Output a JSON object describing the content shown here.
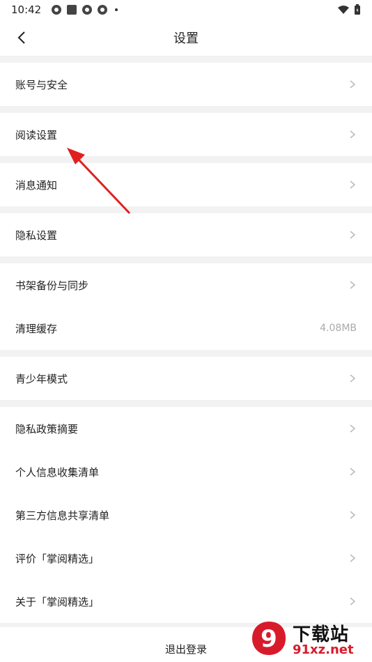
{
  "statusbar": {
    "time": "10:42"
  },
  "navbar": {
    "title": "设置"
  },
  "groups": [
    [
      {
        "label": "账号与安全"
      }
    ],
    [
      {
        "label": "阅读设置"
      }
    ],
    [
      {
        "label": "消息通知"
      }
    ],
    [
      {
        "label": "隐私设置"
      }
    ],
    [
      {
        "label": "书架备份与同步"
      },
      {
        "label": "清理缓存",
        "value": "4.08MB"
      }
    ],
    [
      {
        "label": "青少年模式"
      }
    ],
    [
      {
        "label": "隐私政策摘要"
      },
      {
        "label": "个人信息收集清单"
      },
      {
        "label": "第三方信息共享清单"
      },
      {
        "label": "评价「掌阅精选」"
      },
      {
        "label": "关于「掌阅精选」"
      }
    ]
  ],
  "logout_label": "退出登录",
  "watermark": {
    "brand": "下载站",
    "domain": "91xz.net",
    "badge_text": "9"
  },
  "colors": {
    "annotation_arrow": "#e02020",
    "value_text": "#aaaaaa",
    "watermark_red": "#d81b2b"
  }
}
